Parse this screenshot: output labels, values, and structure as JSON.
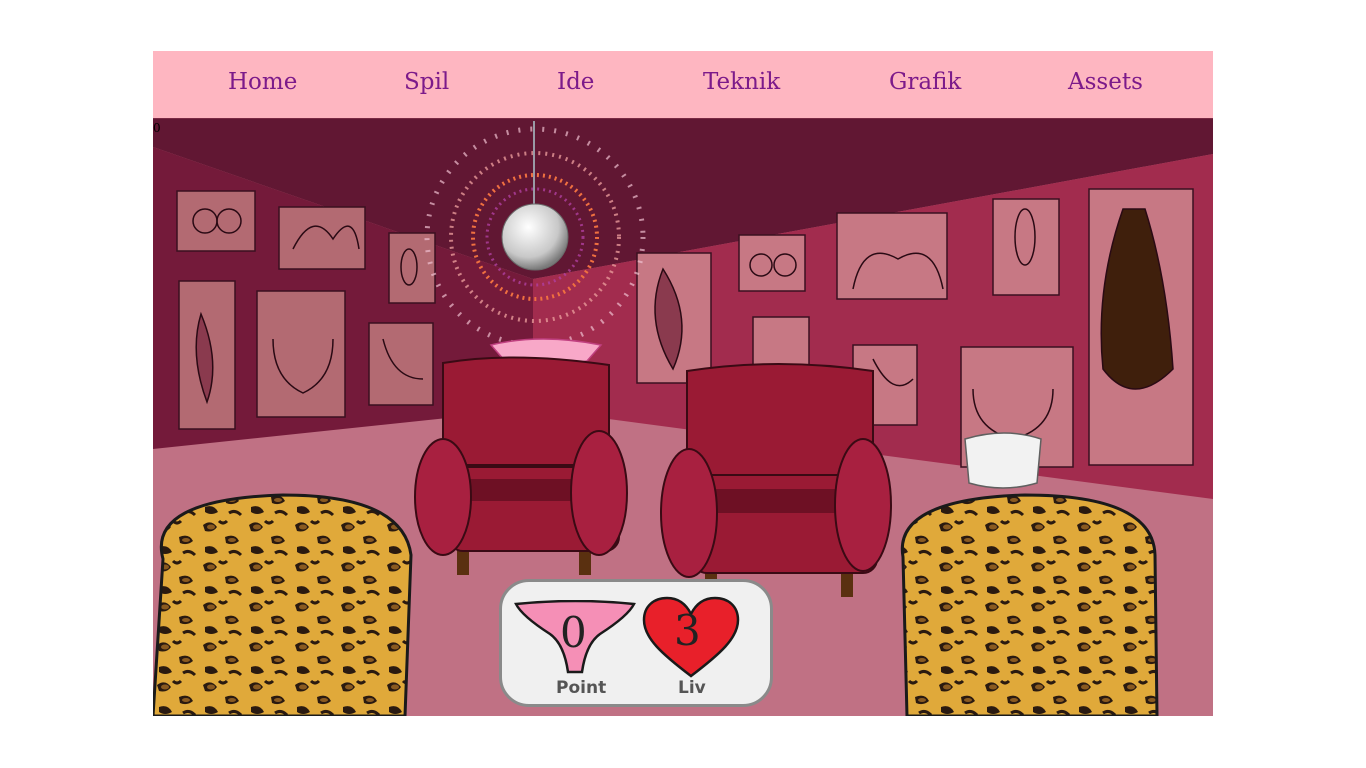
{
  "nav": {
    "items": [
      {
        "label": "Home"
      },
      {
        "label": "Spil"
      },
      {
        "label": "Ide"
      },
      {
        "label": "Teknik"
      },
      {
        "label": "Grafik"
      },
      {
        "label": "Assets"
      }
    ]
  },
  "game": {
    "debug_counter": "0",
    "hud": {
      "points_label": "Point",
      "points_value": "0",
      "lives_label": "Liv",
      "lives_value": "3"
    }
  },
  "colors": {
    "nav_bg": "#feb6c1",
    "nav_text": "#7c1a8a",
    "ceiling": "#611733",
    "wall_left": "#741a3a",
    "wall_right": "#a22c4e",
    "floor": "#c07184",
    "armchair": "#9a1a34",
    "leopard": "#e0a93a",
    "heart": "#e8202a",
    "panties": "#f58fb6"
  }
}
